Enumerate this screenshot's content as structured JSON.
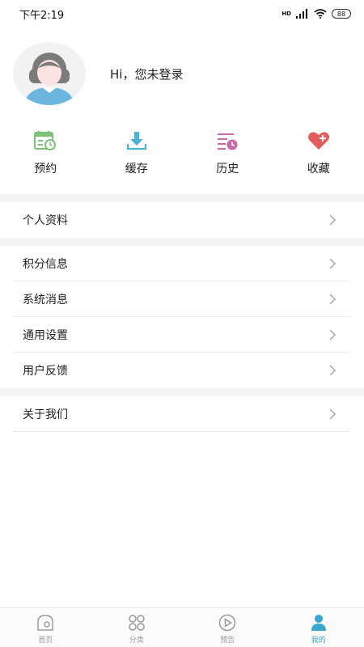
{
  "status_bar": {
    "time": "下午2:19",
    "network_badge": "HD",
    "battery": "88"
  },
  "profile": {
    "greeting": "Hi，您未登录"
  },
  "quick_actions": [
    {
      "label": "预约",
      "icon": "calendar-clock-icon",
      "color": "#7cc37a"
    },
    {
      "label": "缓存",
      "icon": "download-icon",
      "color": "#49b3d8"
    },
    {
      "label": "历史",
      "icon": "history-list-icon",
      "color": "#c86aa8"
    },
    {
      "label": "收藏",
      "icon": "heart-plus-icon",
      "color": "#e35d5b"
    }
  ],
  "menu": {
    "profile_info": "个人资料",
    "points": "积分信息",
    "system_messages": "系统消息",
    "general_settings": "通用设置",
    "feedback": "用户反馈",
    "about": "关于我们"
  },
  "tabs": [
    {
      "label": "首页",
      "icon": "home-icon",
      "active": false
    },
    {
      "label": "分类",
      "icon": "category-grid-icon",
      "active": false
    },
    {
      "label": "预告",
      "icon": "play-icon",
      "active": false
    },
    {
      "label": "我的",
      "icon": "person-icon",
      "active": true
    }
  ],
  "colors": {
    "accent": "#3aa7cf",
    "inactive": "#9a9a9a",
    "divider": "#f4f4f4"
  }
}
